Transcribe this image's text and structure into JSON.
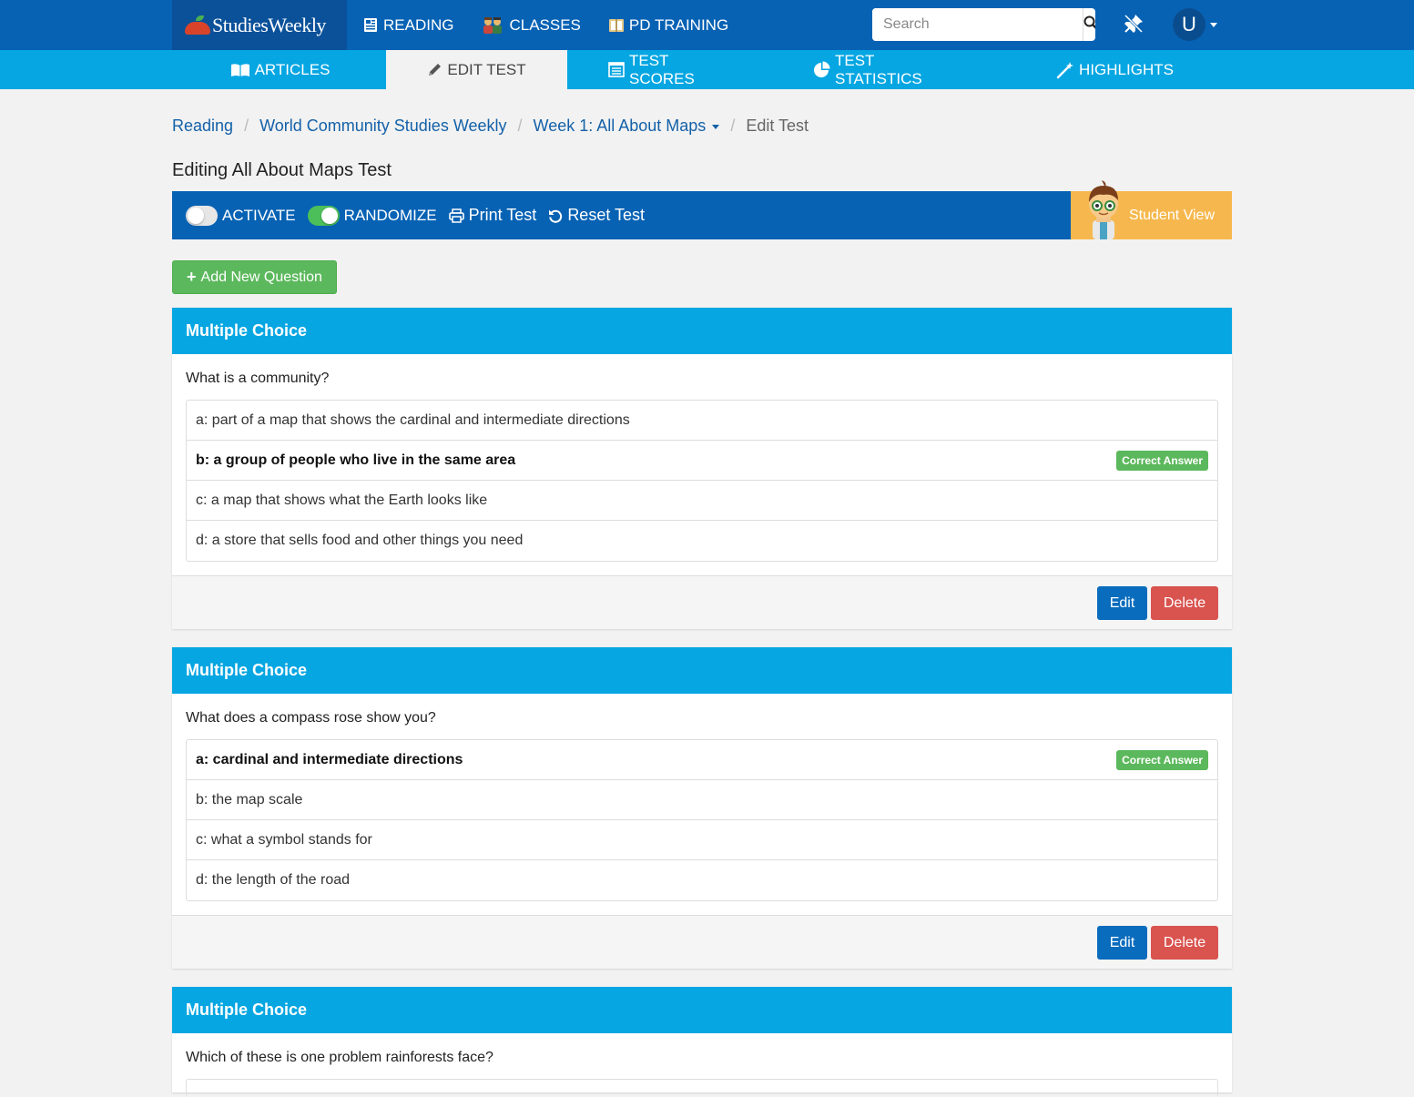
{
  "brand": {
    "name": "StudiesWeekly"
  },
  "topnav": {
    "links": [
      {
        "label": "READING",
        "icon": "newspaper-icon"
      },
      {
        "label": "CLASSES",
        "icon": "classes-icon"
      },
      {
        "label": "PD TRAINING",
        "icon": "book-icon"
      }
    ],
    "search_placeholder": "Search",
    "user_initial": "U"
  },
  "subnav": {
    "tabs": [
      {
        "label": "ARTICLES",
        "icon": "open-book-icon"
      },
      {
        "label": "EDIT TEST",
        "icon": "pencil-icon",
        "active": true
      },
      {
        "label": "TEST SCORES",
        "icon": "list-icon"
      },
      {
        "label": "TEST STATISTICS",
        "icon": "pie-chart-icon"
      },
      {
        "label": "HIGHLIGHTS",
        "icon": "magic-wand-icon"
      }
    ]
  },
  "breadcrumb": {
    "items": [
      "Reading",
      "World Community Studies Weekly",
      "Week 1: All About Maps"
    ],
    "current": "Edit Test"
  },
  "page_title": "Editing All About Maps Test",
  "toolbar": {
    "activate_label": "ACTIVATE",
    "activate_on": false,
    "randomize_label": "RANDOMIZE",
    "randomize_on": true,
    "print_label": "Print Test",
    "reset_label": "Reset Test",
    "student_view_label": "Student View"
  },
  "add_question_label": "Add New Question",
  "questions": [
    {
      "type": "Multiple Choice",
      "text": "What is a community?",
      "options": [
        "a: part of a map that shows the cardinal and intermediate directions",
        "b: a group of people who live in the same area",
        "c: a map that shows what the Earth looks like",
        "d: a store that sells food and other things you need"
      ],
      "correct_index": 1,
      "correct_label": "Correct Answer",
      "edit_label": "Edit",
      "delete_label": "Delete"
    },
    {
      "type": "Multiple Choice",
      "text": "What does a compass rose show you?",
      "options": [
        "a: cardinal and intermediate directions",
        "b: the map scale",
        "c: what a symbol stands for",
        "d: the length of the road"
      ],
      "correct_index": 0,
      "correct_label": "Correct Answer",
      "edit_label": "Edit",
      "delete_label": "Delete"
    },
    {
      "type": "Multiple Choice",
      "text": "Which of these is one problem rainforests face?"
    }
  ],
  "colors": {
    "topnav": "#0762b4",
    "subnav": "#06a6e2",
    "correct": "#5cb85c",
    "delete": "#d9534f",
    "student_view": "#f6b84e"
  }
}
